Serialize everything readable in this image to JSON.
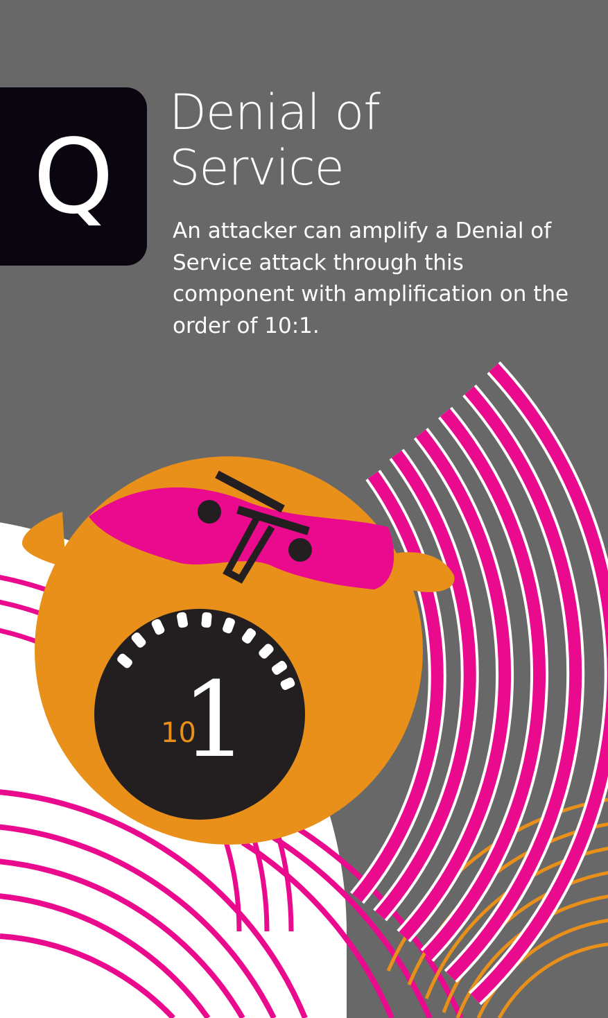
{
  "card": {
    "rank": "Q",
    "title_line1": "Denial of",
    "title_line2": "Service",
    "description": "An attacker can amplify a Denial of Service attack through this component with amplification on the order of 10:1.",
    "ratio_small": "10",
    "ratio_big": "1"
  },
  "colors": {
    "background": "#696868",
    "badge": "#0b0510",
    "magenta": "#ea0a8e",
    "orange": "#e8901a",
    "mouth": "#231f20",
    "white": "#ffffff"
  },
  "icons": {
    "character": "shouting-mask-character-icon",
    "waves": "sound-wave-arcs-icon"
  }
}
